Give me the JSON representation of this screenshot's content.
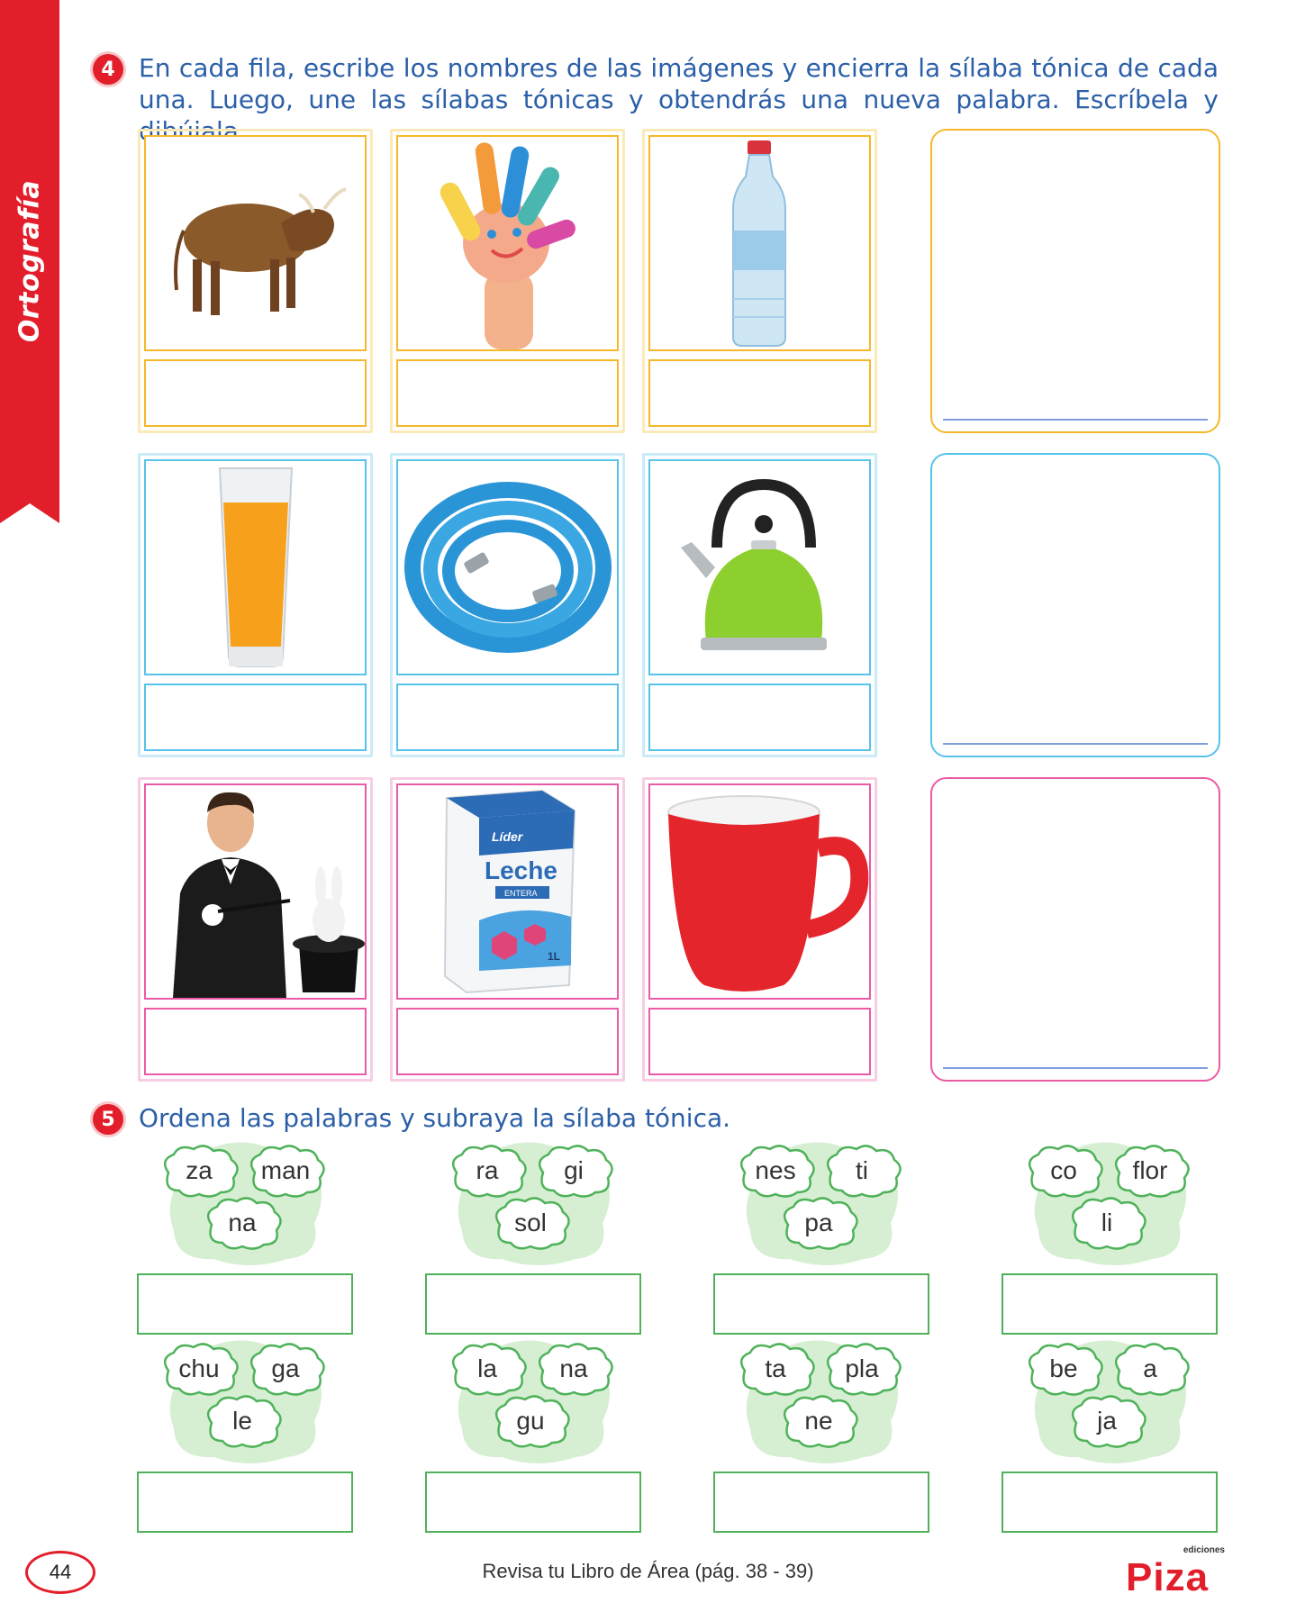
{
  "side_tab": {
    "label": "Ortografía"
  },
  "exercise4": {
    "number": "4",
    "instruction": "En cada fila, escribe los nombres de las imágenes y encierra la sílaba tónica de cada una. Luego, une las sílabas tónicas y obtendrás una nueva palabra. Escríbela y dibújala.",
    "rows": [
      {
        "color": "#f5b82a",
        "images": [
          "bull-icon",
          "painted-hand-icon",
          "water-bottle-icon"
        ]
      },
      {
        "color": "#56c3ea",
        "images": [
          "juice-glass-icon",
          "hose-icon",
          "kettle-icon"
        ]
      },
      {
        "color": "#ea5aa6",
        "images": [
          "magician-icon",
          "milk-carton-icon",
          "mug-icon"
        ]
      }
    ],
    "milk_carton": {
      "brand": "Líder",
      "product": "Leche",
      "variant": "ENTERA",
      "size": "1L"
    }
  },
  "exercise5": {
    "number": "5",
    "instruction": "Ordena las palabras y subraya la sílaba tónica.",
    "groups": [
      {
        "syllables": [
          "za",
          "man",
          "na"
        ]
      },
      {
        "syllables": [
          "ra",
          "gi",
          "sol"
        ]
      },
      {
        "syllables": [
          "nes",
          "ti",
          "pa"
        ]
      },
      {
        "syllables": [
          "co",
          "flor",
          "li"
        ]
      },
      {
        "syllables": [
          "chu",
          "ga",
          "le"
        ]
      },
      {
        "syllables": [
          "la",
          "na",
          "gu"
        ]
      },
      {
        "syllables": [
          "ta",
          "pla",
          "ne"
        ]
      },
      {
        "syllables": [
          "be",
          "a",
          "ja"
        ]
      }
    ]
  },
  "footer": {
    "page_number": "44",
    "text": "Revisa tu Libro de Área (pág. 38 - 39)",
    "logo_brand": "Piza",
    "logo_sub": "ediciones"
  },
  "colors": {
    "accent_red": "#e31e2b",
    "instruction_blue": "#2b5fa8",
    "cloud_green": "#d6efd2",
    "box_green": "#4fb25a"
  }
}
